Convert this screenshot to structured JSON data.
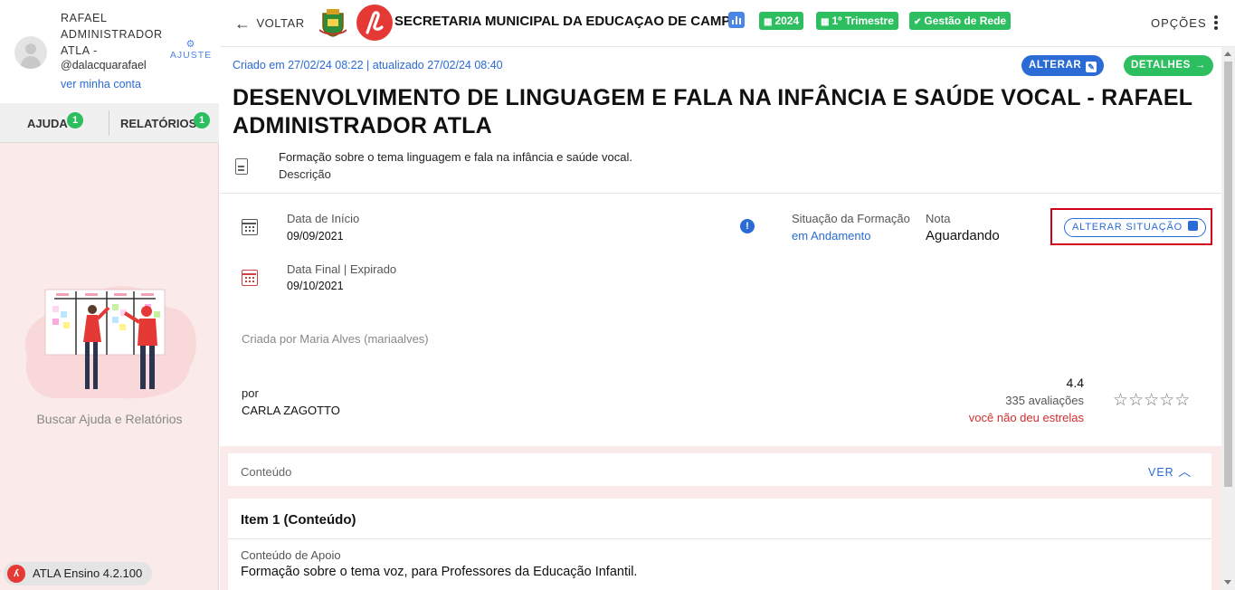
{
  "sidebar": {
    "user_name": "RAFAEL ADMINISTRADOR ATLA -",
    "user_handle": "@dalacquarafael",
    "my_account_link": "ver minha conta",
    "settings_label": "AJUSTE",
    "tabs": [
      {
        "label": "AJUDA",
        "badge": "1"
      },
      {
        "label": "RELATÓRIOS",
        "badge": "1"
      }
    ],
    "help_text": "Buscar Ajuda e Relatórios",
    "version": "ATLA Ensino 4.2.100"
  },
  "header": {
    "back_label": "VOLTAR",
    "org_name": "SECRETARIA MUNICIPAL DA EDUCAÇAO DE CAMPO",
    "tags": [
      "2024",
      "1º Trimestre",
      "Gestão de Rede"
    ],
    "options_label": "OPÇÕES"
  },
  "main": {
    "created_info": "Criado em 27/02/24 08:22 | atualizado 27/02/24 08:40",
    "buttons": {
      "edit": "ALTERAR",
      "details": "DETALHES"
    },
    "title": "DESENVOLVIMENTO DE LINGUAGEM E FALA NA INFÂNCIA E SAÚDE VOCAL - RAFAEL ADMINISTRADOR ATLA",
    "description": "Formação sobre o tema linguagem e fala na infância e saúde vocal.",
    "description_label": "Descrição",
    "start_date_label": "Data de Início",
    "start_date": "09/09/2021",
    "end_date_label": "Data Final | Expirado",
    "end_date": "09/10/2021",
    "status_label": "Situação da Formação",
    "status_value": "em Andamento",
    "grade_label": "Nota",
    "grade_value": "Aguardando",
    "change_status_button": "ALTERAR SITUAÇÃO",
    "created_by": "Criada por Maria Alves (mariaalves)",
    "by_label": "por",
    "by_value": "CARLA ZAGOTTO",
    "rating": {
      "score": "4.4",
      "count": "335 avaliações",
      "notice": "você não deu estrelas",
      "stars_total": 5,
      "stars_given": 0
    },
    "content_section": {
      "label": "Conteúdo",
      "toggle": "VER"
    },
    "item": {
      "title": "Item 1 (Conteúdo)",
      "support_label": "Conteúdo de Apoio",
      "support_text": "Formação sobre o tema voz, para Professores da Educação Infantil."
    }
  },
  "colors": {
    "accent_blue": "#2a6bd6",
    "accent_green": "#2dbe60",
    "brand_red": "#e53935",
    "highlight_red": "#d0021b"
  }
}
